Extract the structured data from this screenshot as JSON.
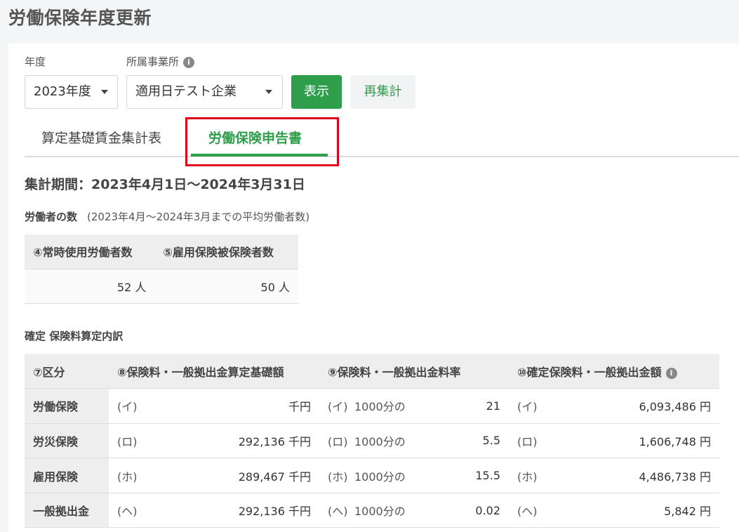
{
  "page": {
    "title": "労働保険年度更新"
  },
  "filters": {
    "year_label": "年度",
    "year_value": "2023年度",
    "office_label": "所属事業所",
    "office_value": "適用日テスト企業",
    "show_button": "表示",
    "recalc_button": "再集計"
  },
  "tabs": [
    {
      "label": "算定基礎賃金集計表"
    },
    {
      "label": "労働保険申告書"
    }
  ],
  "period": "集計期間：2023年4月1日〜2024年3月31日",
  "workers": {
    "label": "労働者の数",
    "sub": "(2023年4月〜2024年3月までの平均労働者数)",
    "headers": [
      "④常時使用労働者数",
      "⑤雇用保険被保険者数"
    ],
    "values": [
      "52 人",
      "50 人"
    ]
  },
  "premium": {
    "label": "確定 保険料算定内訳",
    "headers": [
      "⑦区分",
      "⑧保険料・一般拠出金算定基礎額",
      "⑨保険料・一般拠出金料率",
      "⑩確定保険料・一般拠出金額"
    ],
    "rate_prefix": "1000分の",
    "rows": [
      {
        "name": "労働保険",
        "mark": "(イ)",
        "base": "千円",
        "rate": "21",
        "amount": "6,093,486 円"
      },
      {
        "name": "労災保険",
        "mark": "(ロ)",
        "base": "292,136 千円",
        "rate": "5.5",
        "amount": "1,606,748 円"
      },
      {
        "name": "雇用保険",
        "mark": "(ホ)",
        "base": "289,467 千円",
        "rate": "15.5",
        "amount": "4,486,738 円"
      },
      {
        "name": "一般拠出金",
        "mark": "(ヘ)",
        "base": "292,136 千円",
        "rate": "0.02",
        "amount": "5,842 円"
      }
    ]
  },
  "colors": {
    "accent": "#2e9e4a",
    "highlight": "#e0001b"
  },
  "icons": [
    "info-icon",
    "caret-down-icon"
  ]
}
